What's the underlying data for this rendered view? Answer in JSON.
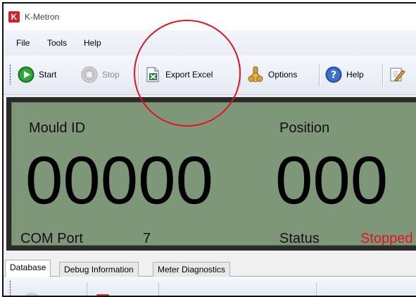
{
  "window": {
    "title": "K-Metron",
    "logo_letter": "K"
  },
  "menu": {
    "items": [
      "File",
      "Tools",
      "Help"
    ]
  },
  "toolbar": {
    "start_label": "Start",
    "stop_label": "Stop",
    "export_label": "Export Excel",
    "options_label": "Options",
    "help_label": "Help"
  },
  "display": {
    "mould_id_label": "Mould ID",
    "mould_id_value": "00000",
    "position_label": "Position",
    "position_value": "000",
    "com_port_label": "COM Port",
    "com_port_value": "7",
    "status_label": "Status",
    "status_value": "Stopped"
  },
  "tabs": [
    "Database",
    "Debug Information",
    "Meter Diagnostics"
  ],
  "active_tab": "Database",
  "colors": {
    "display_bg": "#7f9779",
    "status_stopped": "#e0161e",
    "annotation": "#e0141e",
    "logo": "#d0202a"
  },
  "icons": {
    "start": "play-circle-icon",
    "stop": "stop-circle-icon",
    "export": "excel-export-icon",
    "options": "options-gear-icon",
    "help": "help-question-icon",
    "edit": "edit-icon"
  }
}
